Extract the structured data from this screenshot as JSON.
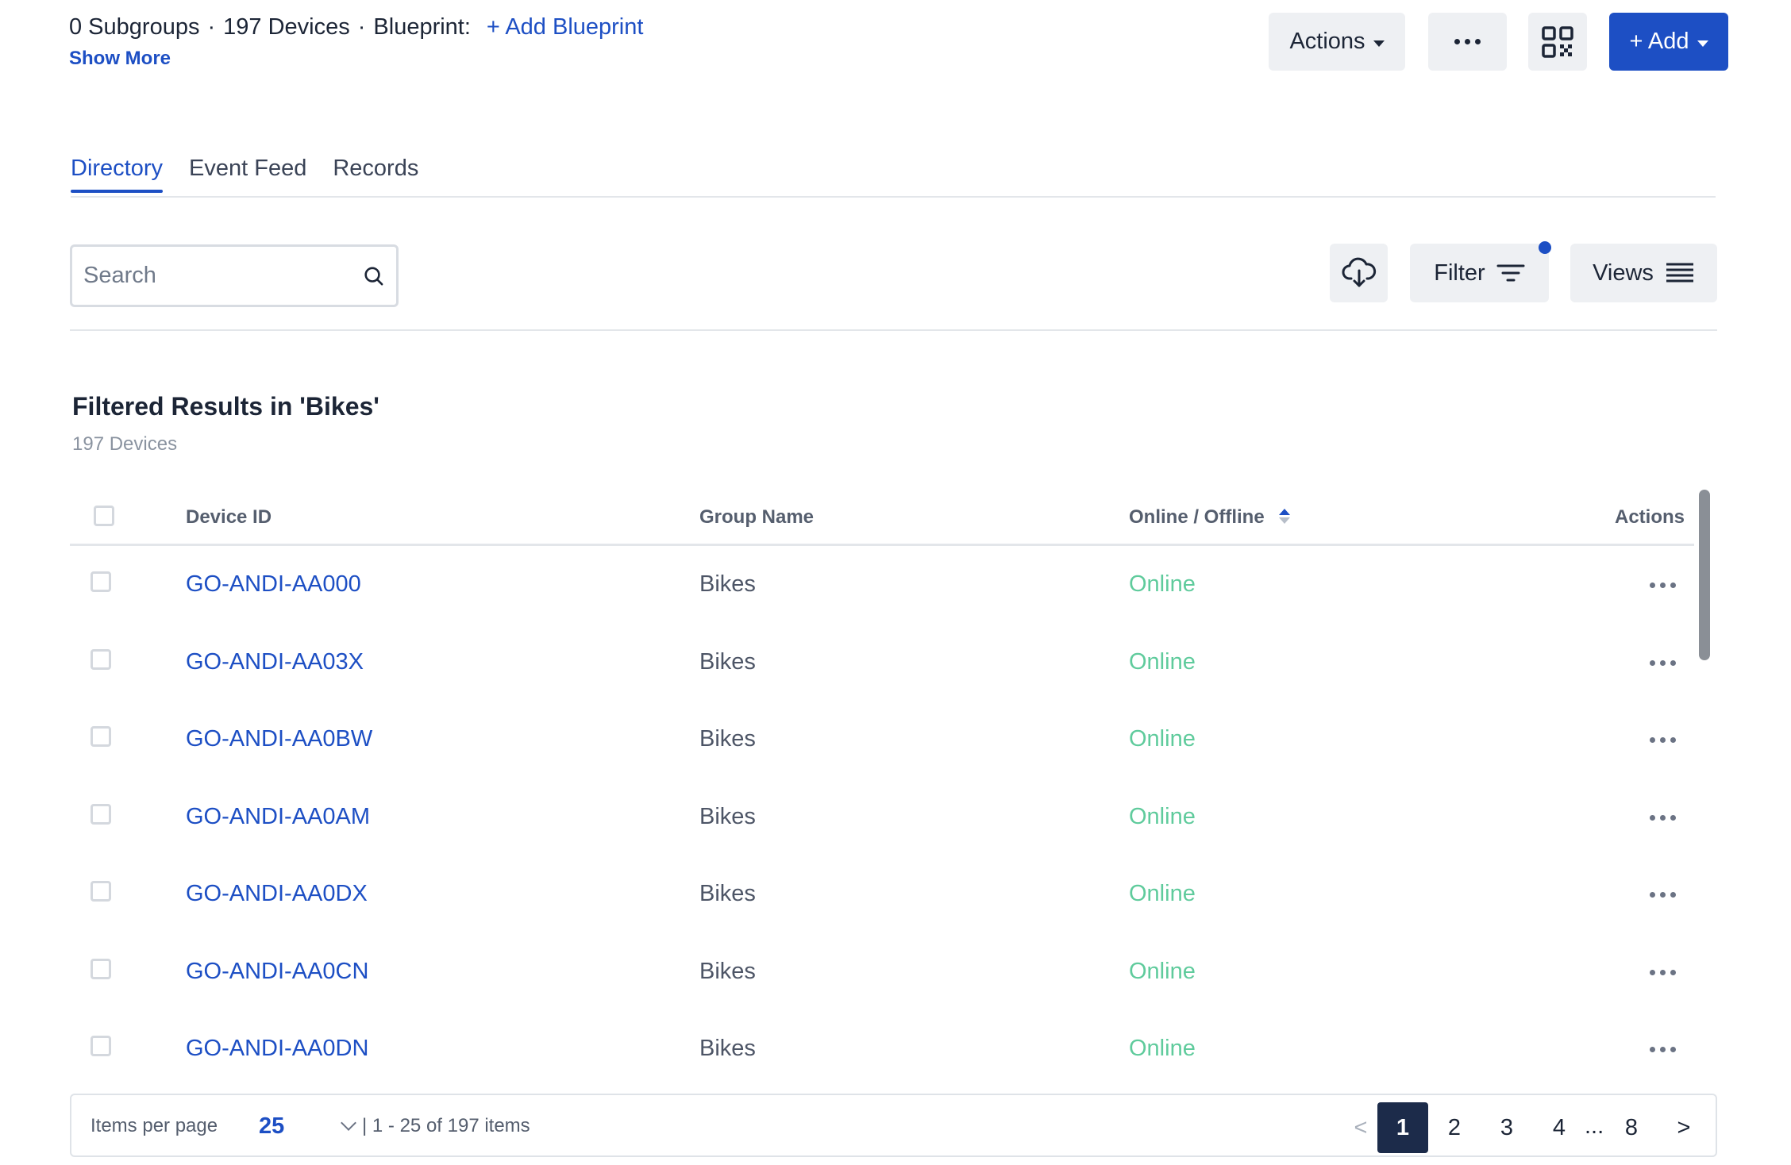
{
  "header": {
    "subgroups": "0 Subgroups",
    "devices": "197 Devices",
    "blueprint_label": "Blueprint:",
    "add_blueprint": "+ Add Blueprint",
    "show_more": "Show More",
    "actions_label": "Actions",
    "add_label": "+ Add"
  },
  "tabs": [
    {
      "label": "Directory",
      "active": true
    },
    {
      "label": "Event Feed",
      "active": false
    },
    {
      "label": "Records",
      "active": false
    }
  ],
  "toolbar": {
    "search_placeholder": "Search",
    "filter_label": "Filter",
    "views_label": "Views"
  },
  "results": {
    "title": "Filtered Results in 'Bikes'",
    "count": "197 Devices"
  },
  "table": {
    "columns": {
      "device_id": "Device ID",
      "group_name": "Group Name",
      "status": "Online / Offline",
      "actions": "Actions"
    },
    "rows": [
      {
        "id": "GO-ANDI-AA000",
        "group": "Bikes",
        "status": "Online"
      },
      {
        "id": "GO-ANDI-AA03X",
        "group": "Bikes",
        "status": "Online"
      },
      {
        "id": "GO-ANDI-AA0BW",
        "group": "Bikes",
        "status": "Online"
      },
      {
        "id": "GO-ANDI-AA0AM",
        "group": "Bikes",
        "status": "Online"
      },
      {
        "id": "GO-ANDI-AA0DX",
        "group": "Bikes",
        "status": "Online"
      },
      {
        "id": "GO-ANDI-AA0CN",
        "group": "Bikes",
        "status": "Online"
      },
      {
        "id": "GO-ANDI-AA0DN",
        "group": "Bikes",
        "status": "Online"
      }
    ]
  },
  "pagination": {
    "items_per_page_label": "Items per page",
    "items_per_page": "25",
    "range": "| 1 - 25 of 197 items",
    "prev": "<",
    "next": ">",
    "pages": [
      "1",
      "2",
      "3",
      "4"
    ],
    "ellipsis": "...",
    "last_page": "8",
    "current_page": "1"
  },
  "colors": {
    "accent": "#1d4fc4",
    "online": "#5fcb9c",
    "active_page": "#1c2b4a"
  }
}
